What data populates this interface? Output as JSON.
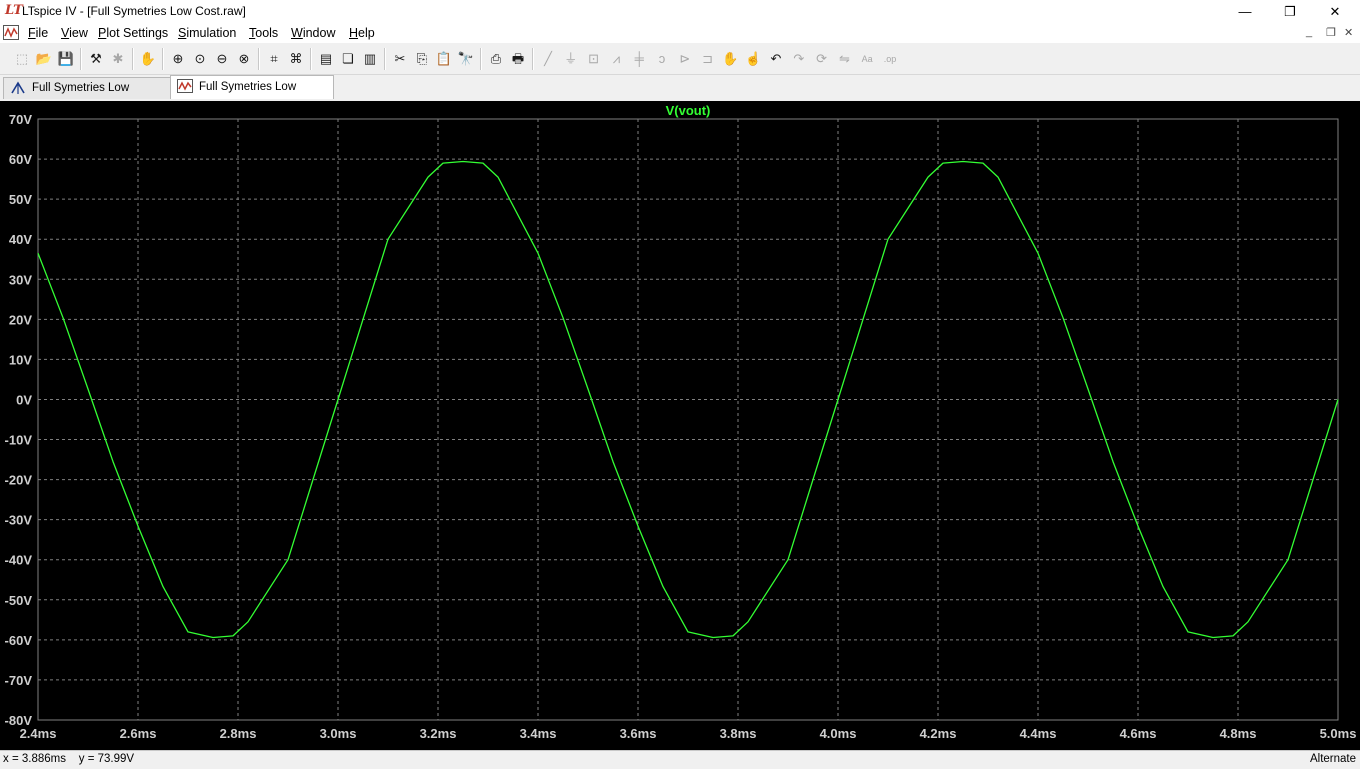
{
  "window": {
    "title": "LTspice IV - [Full Symetries Low Cost.raw]",
    "logo_text": "LT",
    "minimize_glyph": "—",
    "restore_glyph": "❐",
    "close_glyph": "✕"
  },
  "menu": {
    "items": [
      {
        "key": "F",
        "rest": "ile"
      },
      {
        "key": "V",
        "rest": "iew"
      },
      {
        "key": "P",
        "rest": "lot Settings"
      },
      {
        "key": "S",
        "rest": "imulation"
      },
      {
        "key": "T",
        "rest": "ools"
      },
      {
        "key": "W",
        "rest": "indow"
      },
      {
        "key": "H",
        "rest": "elp"
      }
    ],
    "mdi_minimize": "_",
    "mdi_restore": "❐",
    "mdi_close": "✕"
  },
  "toolbar": {
    "icons": [
      {
        "name": "new-schematic-icon",
        "glyph": "⬚",
        "enabled": false
      },
      {
        "name": "open-icon",
        "glyph": "📂",
        "enabled": true
      },
      {
        "name": "save-icon",
        "glyph": "💾",
        "enabled": true
      },
      {
        "name": "control-panel-icon",
        "glyph": "⚒",
        "enabled": true
      },
      {
        "name": "run-icon",
        "glyph": "✱",
        "enabled": false
      },
      {
        "name": "halt-icon",
        "glyph": "✋",
        "enabled": true
      },
      {
        "name": "zoom-in-icon",
        "glyph": "⊕",
        "enabled": true
      },
      {
        "name": "pan-icon",
        "glyph": "⊙",
        "enabled": true
      },
      {
        "name": "zoom-out-icon",
        "glyph": "⊖",
        "enabled": true
      },
      {
        "name": "zoom-fit-icon",
        "glyph": "⊗",
        "enabled": true
      },
      {
        "name": "autorange-icon",
        "glyph": "⌗",
        "enabled": true
      },
      {
        "name": "zoom-extents-icon",
        "glyph": "⌘",
        "enabled": true
      },
      {
        "name": "tile-horizontal-icon",
        "glyph": "▤",
        "enabled": true
      },
      {
        "name": "cascade-icon",
        "glyph": "❏",
        "enabled": true
      },
      {
        "name": "tile-vertical-icon",
        "glyph": "▥",
        "enabled": true
      },
      {
        "name": "cut-icon",
        "glyph": "✂",
        "enabled": true
      },
      {
        "name": "copy-icon",
        "glyph": "⎘",
        "enabled": true
      },
      {
        "name": "paste-icon",
        "glyph": "📋",
        "enabled": true
      },
      {
        "name": "find-icon",
        "glyph": "🔭",
        "enabled": true
      },
      {
        "name": "print-preview-icon",
        "glyph": "⎙",
        "enabled": true
      },
      {
        "name": "print-icon",
        "glyph": "🖶",
        "enabled": true
      },
      {
        "name": "draw-wire-icon",
        "glyph": "╱",
        "enabled": false
      },
      {
        "name": "ground-icon",
        "glyph": "⏚",
        "enabled": false
      },
      {
        "name": "label-net-icon",
        "glyph": "⊡",
        "enabled": false
      },
      {
        "name": "resistor-icon",
        "glyph": "⩘",
        "enabled": false
      },
      {
        "name": "capacitor-icon",
        "glyph": "╪",
        "enabled": false
      },
      {
        "name": "inductor-icon",
        "glyph": "ↄ",
        "enabled": false
      },
      {
        "name": "diode-icon",
        "glyph": "⊳",
        "enabled": false
      },
      {
        "name": "component-icon",
        "glyph": "⊐",
        "enabled": false
      },
      {
        "name": "move-icon",
        "glyph": "✋",
        "enabled": false
      },
      {
        "name": "drag-icon",
        "glyph": "☝",
        "enabled": false
      },
      {
        "name": "undo-icon",
        "glyph": "↶",
        "enabled": true
      },
      {
        "name": "redo-icon",
        "glyph": "↷",
        "enabled": false
      },
      {
        "name": "rotate-icon",
        "glyph": "⟳",
        "enabled": false
      },
      {
        "name": "mirror-icon",
        "glyph": "⇋",
        "enabled": false
      },
      {
        "name": "text-icon",
        "glyph": "Aa",
        "enabled": false
      },
      {
        "name": "spice-directive-icon",
        "glyph": ".op",
        "enabled": false
      }
    ]
  },
  "tabs": [
    {
      "label": "Full Symetries Low Cost.asc",
      "active": false,
      "icon": "schematic-icon"
    },
    {
      "label": "Full Symetries Low Cost.raw",
      "active": true,
      "icon": "waveform-icon"
    }
  ],
  "status": {
    "coords": "x = 3.886ms    y = 73.99V",
    "mode": "Alternate"
  },
  "colors": {
    "trace": "#33ff33",
    "grid": "#808080",
    "axis_text": "#cfcfcf",
    "background": "#000000"
  },
  "chart_data": {
    "type": "line",
    "title": "V(vout)",
    "xlabel": "",
    "ylabel": "",
    "xlim": [
      2.4,
      5.0
    ],
    "ylim": [
      -80,
      70
    ],
    "x_unit": "ms",
    "y_unit": "V",
    "x_ticks": [
      "2.4ms",
      "2.6ms",
      "2.8ms",
      "3.0ms",
      "3.2ms",
      "3.4ms",
      "3.6ms",
      "3.8ms",
      "4.0ms",
      "4.2ms",
      "4.4ms",
      "4.6ms",
      "4.8ms",
      "5.0ms"
    ],
    "y_ticks": [
      "70V",
      "60V",
      "50V",
      "40V",
      "30V",
      "20V",
      "10V",
      "0V",
      "-10V",
      "-20V",
      "-30V",
      "-40V",
      "-50V",
      "-60V",
      "-70V",
      "-80V"
    ],
    "grid": true,
    "series": [
      {
        "name": "V(vout)",
        "color": "#33ff33",
        "points": [
          [
            2.4,
            36.5
          ],
          [
            2.45,
            20.4
          ],
          [
            2.5,
            2.6
          ],
          [
            2.55,
            -15.5
          ],
          [
            2.6,
            -31.6
          ],
          [
            2.65,
            -46.7
          ],
          [
            2.7,
            -58.0
          ],
          [
            2.75,
            -59.4
          ],
          [
            2.79,
            -59.0
          ],
          [
            2.82,
            -55.5
          ],
          [
            2.9,
            -40.0
          ],
          [
            3.0,
            0.0
          ],
          [
            3.1,
            40.0
          ],
          [
            3.18,
            55.5
          ],
          [
            3.21,
            59.0
          ],
          [
            3.25,
            59.4
          ],
          [
            3.29,
            59.0
          ],
          [
            3.32,
            55.5
          ],
          [
            3.4,
            36.5
          ],
          [
            3.45,
            20.4
          ],
          [
            3.5,
            2.6
          ],
          [
            3.55,
            -15.5
          ],
          [
            3.6,
            -31.6
          ],
          [
            3.65,
            -46.7
          ],
          [
            3.7,
            -58.0
          ],
          [
            3.75,
            -59.4
          ],
          [
            3.79,
            -59.0
          ],
          [
            3.82,
            -55.5
          ],
          [
            3.9,
            -40.0
          ],
          [
            4.0,
            0.0
          ],
          [
            4.1,
            40.0
          ],
          [
            4.18,
            55.5
          ],
          [
            4.21,
            59.0
          ],
          [
            4.25,
            59.4
          ],
          [
            4.29,
            59.0
          ],
          [
            4.32,
            55.5
          ],
          [
            4.4,
            36.5
          ],
          [
            4.45,
            20.4
          ],
          [
            4.5,
            2.6
          ],
          [
            4.55,
            -15.5
          ],
          [
            4.6,
            -31.6
          ],
          [
            4.65,
            -46.7
          ],
          [
            4.7,
            -58.0
          ],
          [
            4.75,
            -59.4
          ],
          [
            4.79,
            -59.0
          ],
          [
            4.82,
            -55.5
          ],
          [
            4.9,
            -40.0
          ],
          [
            5.0,
            0.0
          ]
        ]
      }
    ]
  }
}
